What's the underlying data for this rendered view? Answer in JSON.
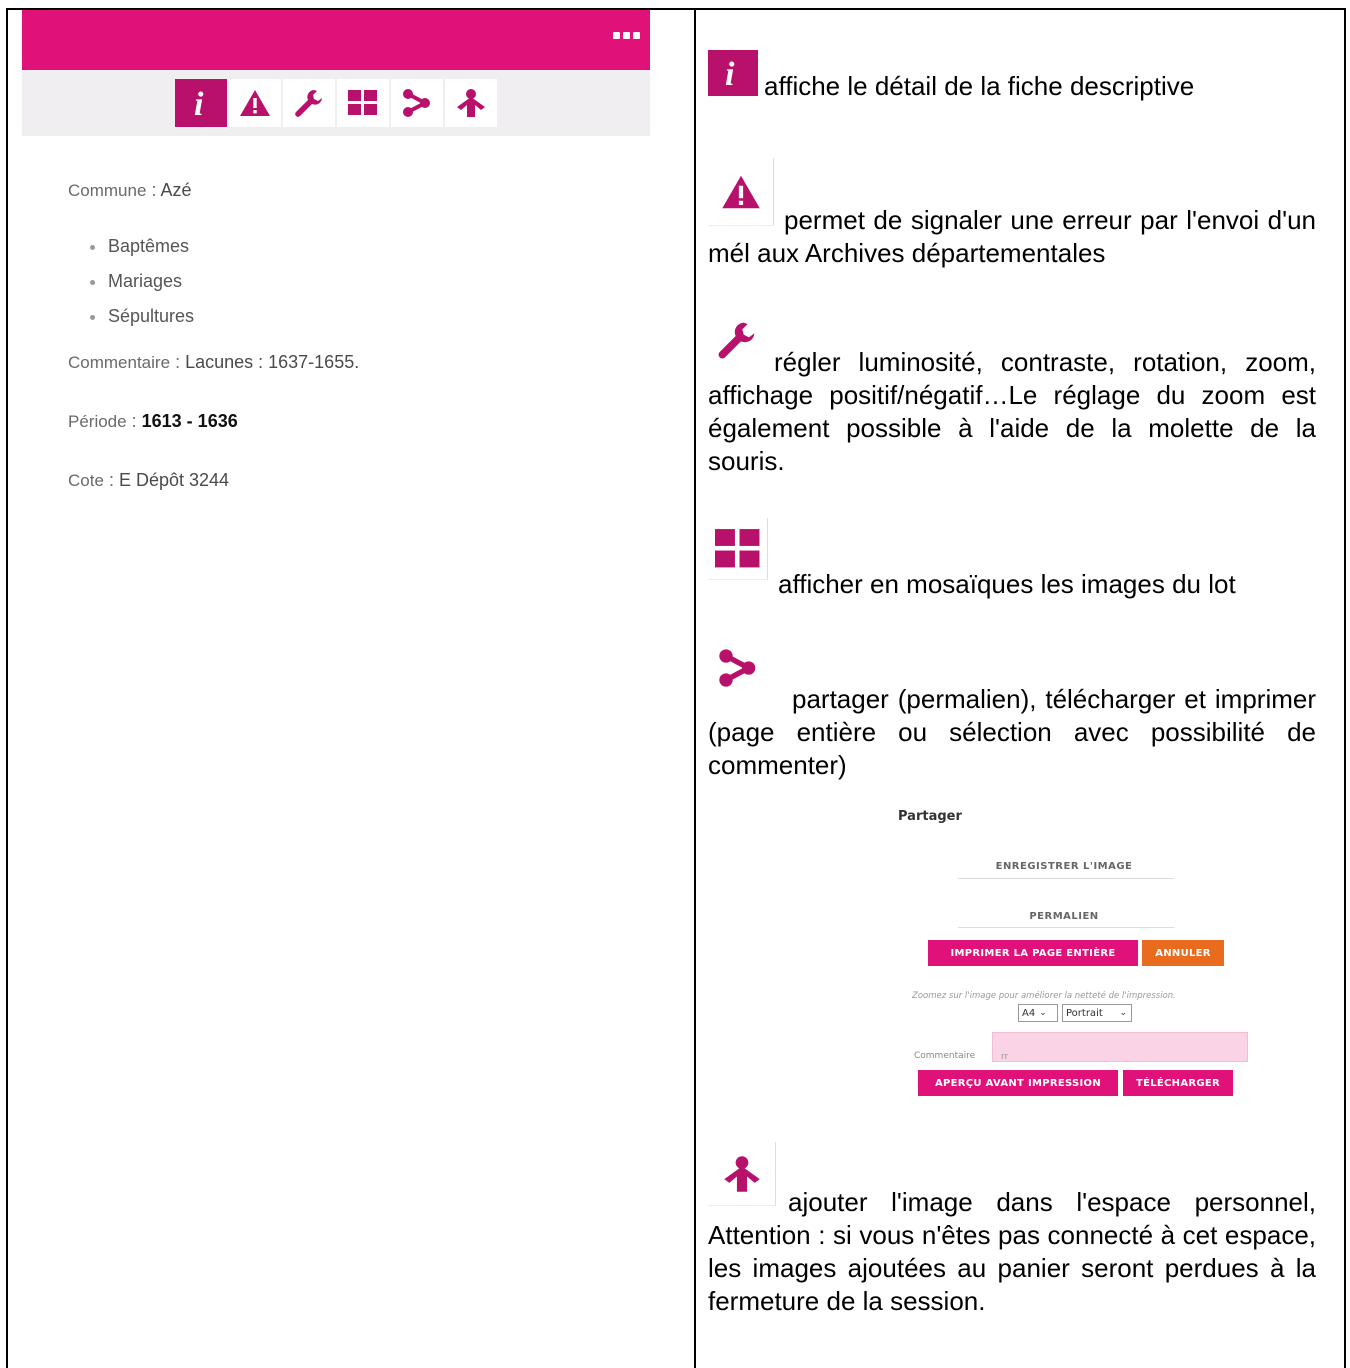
{
  "viewer": {
    "toolbar": [
      {
        "icon": "info-icon",
        "active": true
      },
      {
        "icon": "warning-icon"
      },
      {
        "icon": "wrench-icon"
      },
      {
        "icon": "grid-icon"
      },
      {
        "icon": "share-icon"
      },
      {
        "icon": "person-icon"
      }
    ],
    "metadata": {
      "commune_label": "Commune",
      "commune_value": "Azé",
      "types": [
        "Baptêmes",
        "Mariages",
        "Sépultures"
      ],
      "commentaire_label": "Commentaire",
      "commentaire_value": "Lacunes : 1637-1655.",
      "periode_label": "Période",
      "periode_value": "1613 - 1636",
      "cote_label": "Cote",
      "cote_value": "E Dépôt 3244",
      "separator": ":"
    }
  },
  "legend": {
    "info": "affiche le détail de la fiche descriptive",
    "warning": "permet de signaler une erreur par l'envoi d'un mél aux Archives départementales",
    "wrench": "régler luminosité, contraste, rotation, zoom, affichage positif/négatif…Le réglage du zoom est également possible à l'aide de la molette de la souris.",
    "grid": "afficher en mosaïques les images du lot",
    "share": "partager (permalien), télécharger et imprimer (page entière ou sélection avec possibilité de commenter)",
    "person": "ajouter l'image dans l'espace personnel, Attention : si vous n'êtes pas connecté à cet espace, les images ajoutées au panier seront perdues à la fermeture de la session."
  },
  "share_panel": {
    "title": "Partager",
    "save_image": "ENREGISTRER L'IMAGE",
    "permalink": "PERMALIEN",
    "print_full": "IMPRIMER LA PAGE ENTIÈRE",
    "cancel": "ANNULER",
    "hint": "Zoomez sur l'image pour améliorer la netteté de l'impression.",
    "paper_size": "A4",
    "orientation": "Portrait",
    "comment_label": "Commentaire",
    "comment_value": "rr",
    "preview": "APERÇU AVANT IMPRESSION",
    "download": "TÉLÉCHARGER"
  },
  "colors": {
    "accent": "#e0127a",
    "icon": "#b8116c",
    "cancel": "#e86b1e"
  }
}
